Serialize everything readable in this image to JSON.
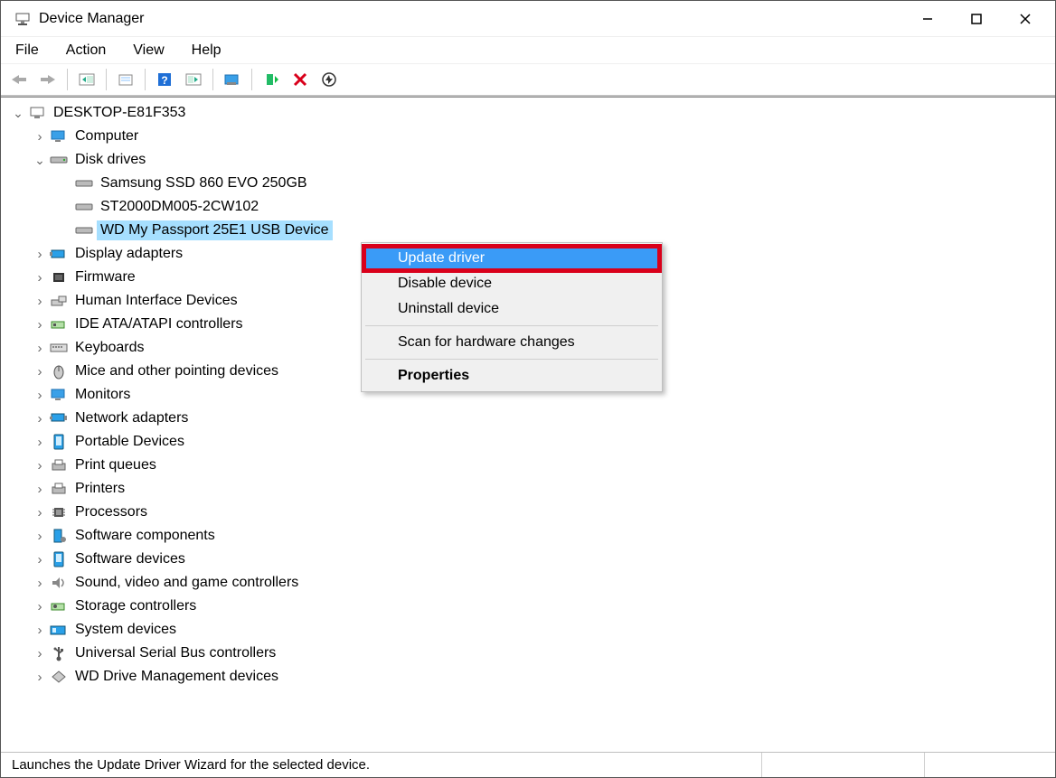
{
  "title": "Device Manager",
  "menus": {
    "file": "File",
    "action": "Action",
    "view": "View",
    "help": "Help"
  },
  "root": "DESKTOP-E81F353",
  "disk_drives_label": "Disk drives",
  "drives": {
    "0": "Samsung SSD 860 EVO 250GB",
    "1": "ST2000DM005-2CW102",
    "2": "WD My Passport 25E1 USB Device"
  },
  "cats": {
    "computer": "Computer",
    "display": "Display adapters",
    "firmware": "Firmware",
    "hid": "Human Interface Devices",
    "ide": "IDE ATA/ATAPI controllers",
    "keyboards": "Keyboards",
    "mice": "Mice and other pointing devices",
    "monitors": "Monitors",
    "network": "Network adapters",
    "portable": "Portable Devices",
    "printq": "Print queues",
    "printers": "Printers",
    "processors": "Processors",
    "swcomp": "Software components",
    "swdev": "Software devices",
    "sound": "Sound, video and game controllers",
    "storage": "Storage controllers",
    "sysdev": "System devices",
    "usb": "Universal Serial Bus controllers",
    "wd": "WD Drive Management devices"
  },
  "context": {
    "update": "Update driver",
    "disable": "Disable device",
    "uninstall": "Uninstall device",
    "scan": "Scan for hardware changes",
    "properties": "Properties"
  },
  "status": "Launches the Update Driver Wizard for the selected device."
}
